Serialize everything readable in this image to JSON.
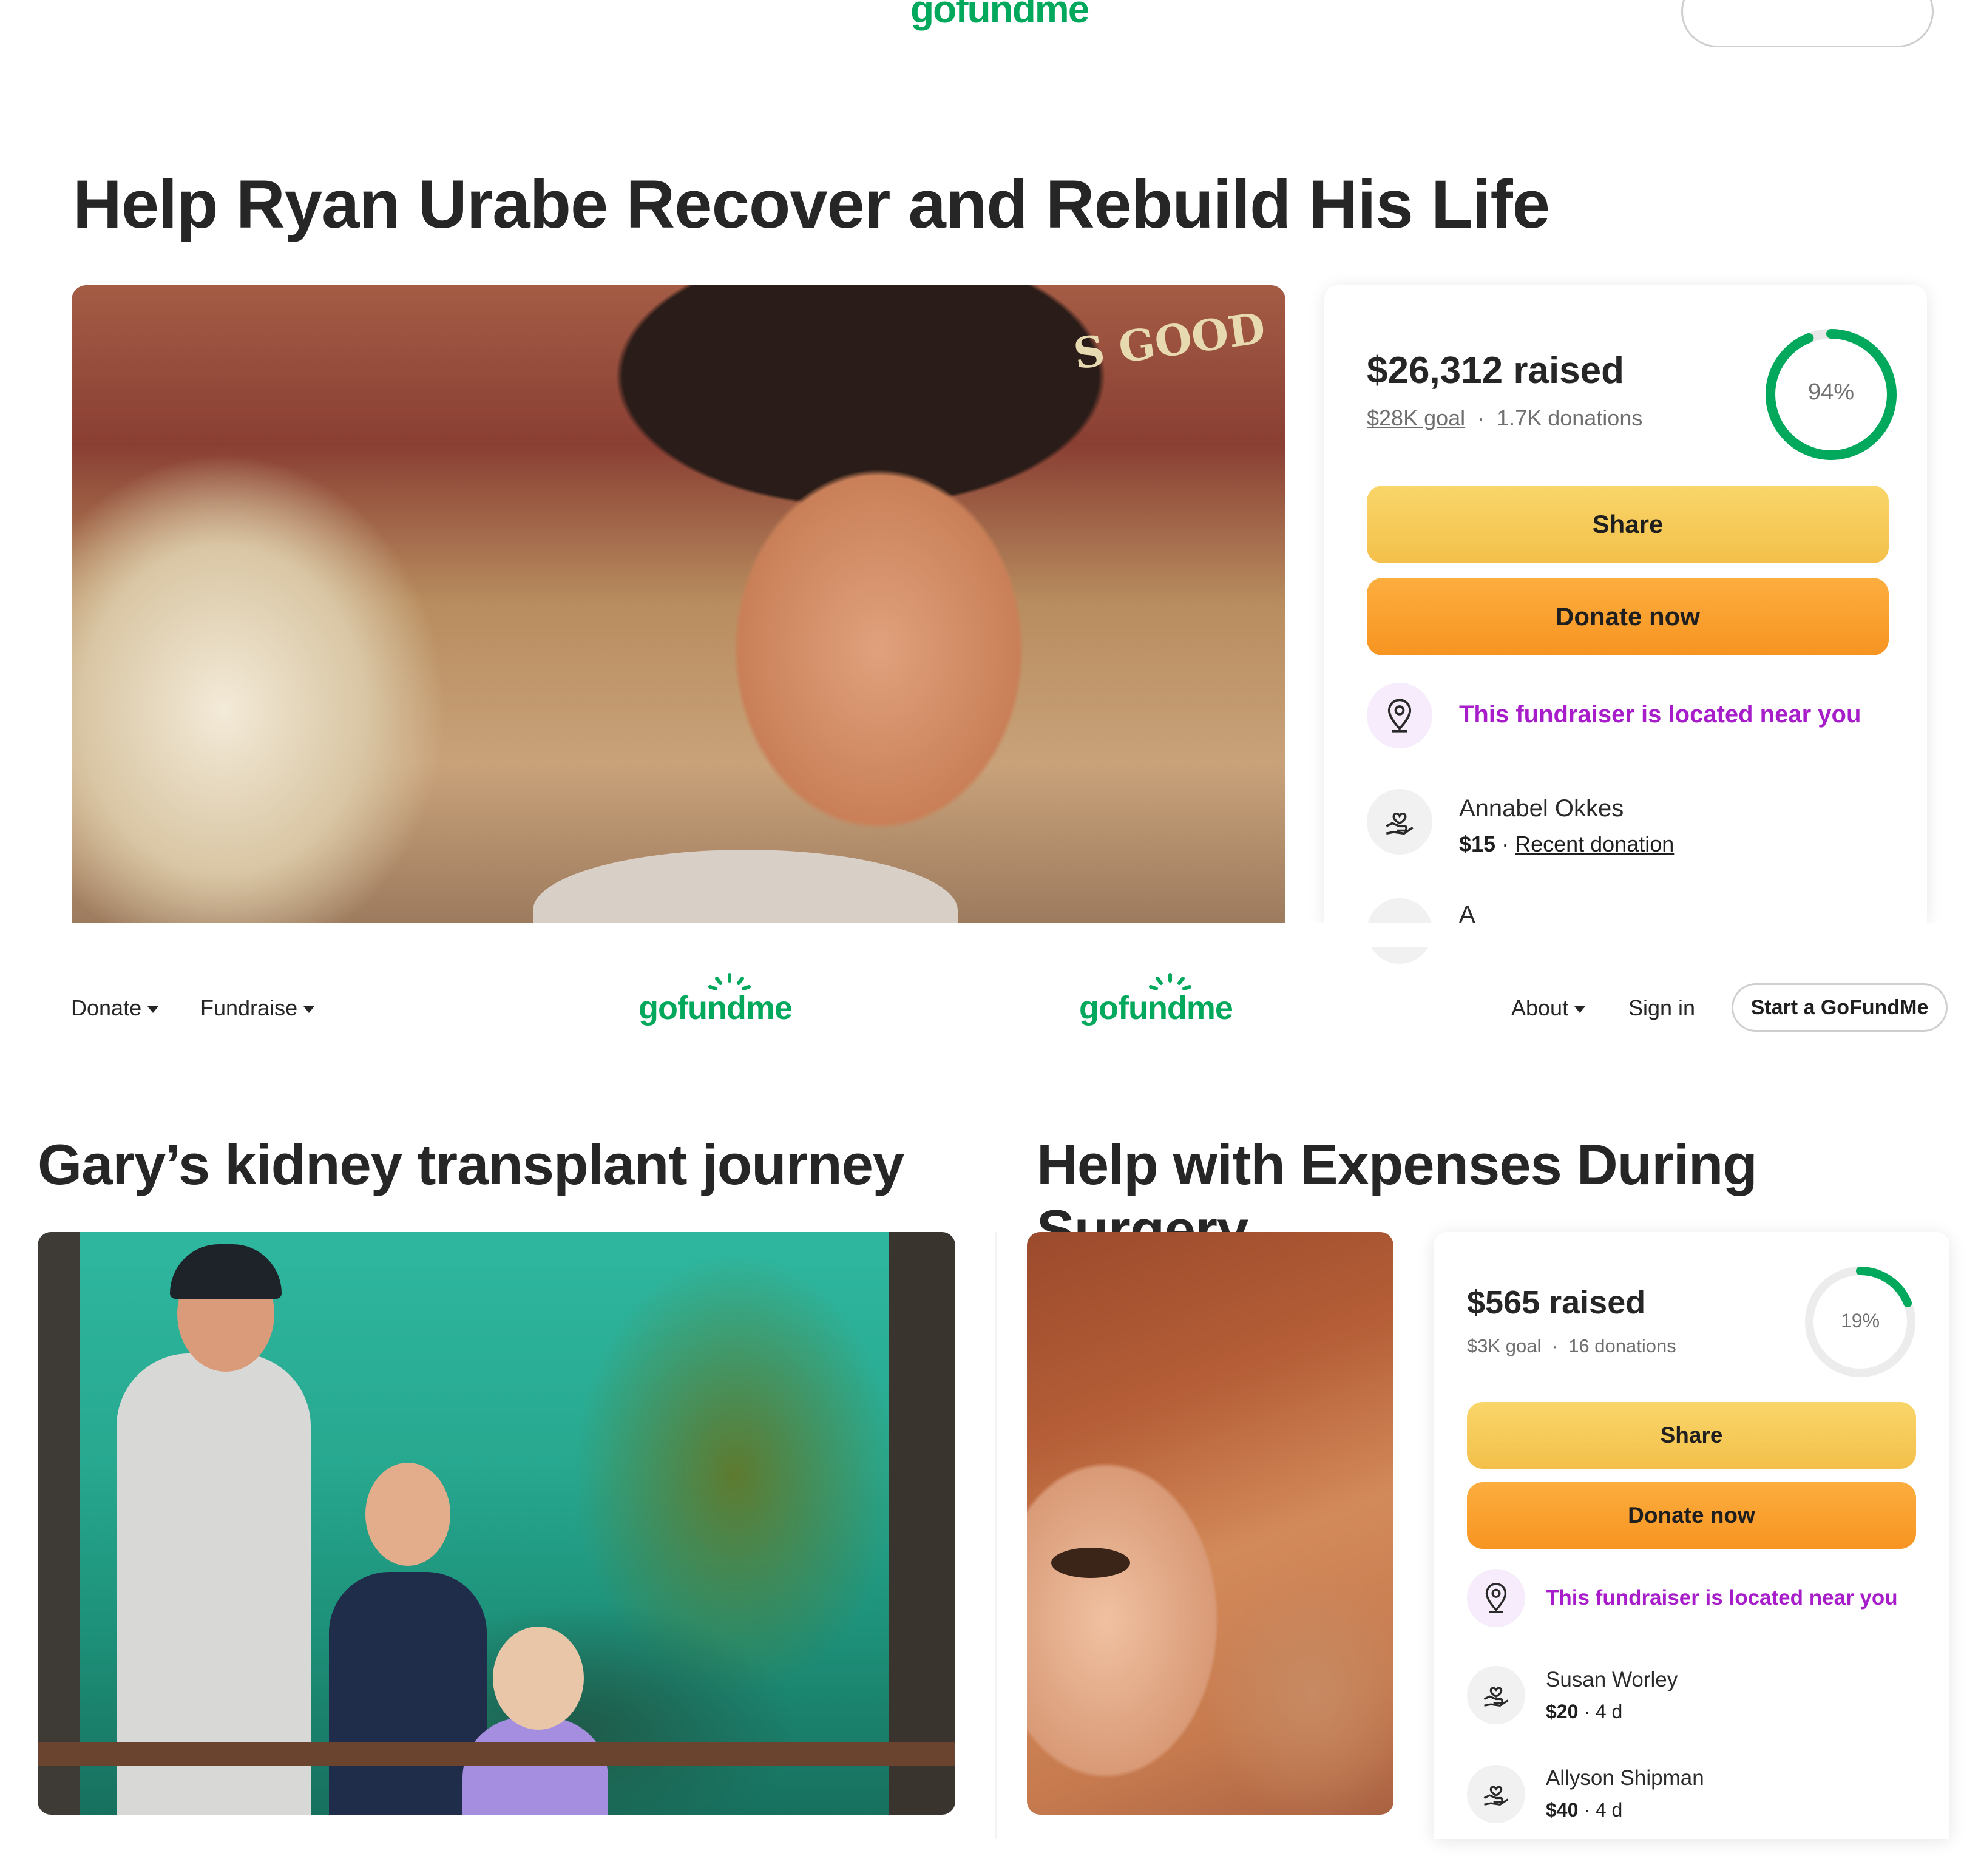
{
  "top_header": {
    "logo_partial": "gofundme"
  },
  "fundraiser1": {
    "title": "Help Ryan Urabe Recover and Rebuild His Life",
    "photo_sign_text": "S GOOD",
    "raised": "$26,312 raised",
    "goal": "$28K goal",
    "donations": "1.7K donations",
    "percent": "94%",
    "progress": 0.94,
    "share_label": "Share",
    "donate_label": "Donate now",
    "near_text": "This fundraiser is located near you",
    "donors": [
      {
        "name": "Annabel Okkes",
        "amount": "$15",
        "note": "Recent donation"
      }
    ],
    "cut_donor_initial": "A"
  },
  "nav": {
    "donate": "Donate",
    "fundraise": "Fundraise",
    "logo": "gofundme",
    "about": "About",
    "sign_in": "Sign in",
    "start": "Start a GoFundMe"
  },
  "fundraiser2": {
    "title": "Gary’s kidney transplant journey"
  },
  "fundraiser3": {
    "title": "Help with Expenses During Surgery",
    "raised": "$565 raised",
    "goal": "$3K goal",
    "donations": "16 donations",
    "percent": "19%",
    "progress": 0.19,
    "share_label": "Share",
    "donate_label": "Donate now",
    "near_text": "This fundraiser is located near you",
    "donors": [
      {
        "name": "Susan Worley",
        "amount": "$20",
        "time": "4 d"
      },
      {
        "name": "Allyson Shipman",
        "amount": "$40",
        "time": "4 d"
      }
    ]
  },
  "colors": {
    "brand_green": "#02a95c",
    "accent_purple": "#a61dc9",
    "share_yellow": "#f6c94f",
    "donate_orange": "#f99a2a"
  }
}
